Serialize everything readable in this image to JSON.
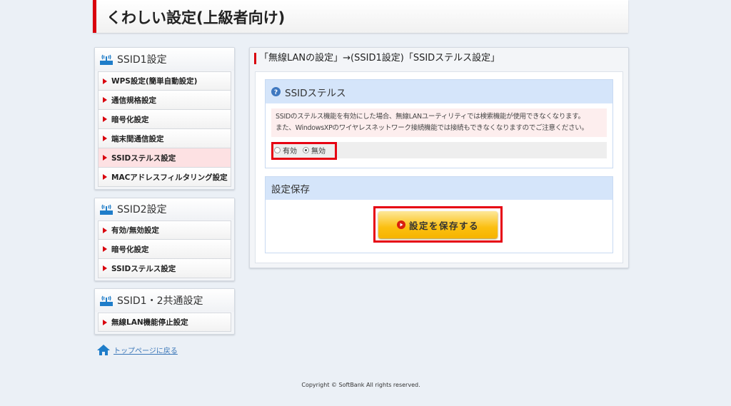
{
  "header": {
    "title": "くわしい設定(上級者向け)"
  },
  "sidebar": {
    "groups": [
      {
        "title": "SSID1設定",
        "items": [
          "WPS設定(簡単自動設定)",
          "通信規格設定",
          "暗号化設定",
          "端末間通信設定",
          "SSIDステルス設定",
          "MACアドレスフィルタリング設定"
        ]
      },
      {
        "title": "SSID2設定",
        "items": [
          "有効/無効設定",
          "暗号化設定",
          "SSIDステルス設定"
        ]
      },
      {
        "title": "SSID1・2共通設定",
        "items": [
          "無線LAN機能停止設定"
        ]
      }
    ],
    "top_link": "トップページに戻る"
  },
  "main": {
    "breadcrumb": "「無線LANの設定」→(SSID1設定)「SSIDステルス設定」",
    "stealth": {
      "title": "SSIDステルス",
      "notice1": "SSIDのステルス機能を有効にした場合、無線LANユーティリティでは検索機能が使用できなくなります。",
      "notice2": "また、WindowsXPのワイヤレスネットワーク接続機能では接続もできなくなりますのでご注意ください。",
      "option_enable": "有効",
      "option_disable": "無効",
      "selected": "無効"
    },
    "save": {
      "title": "設定保存",
      "button": "設定を保存する"
    }
  },
  "footer": {
    "copyright": "Copyright © SoftBank All rights reserved."
  }
}
